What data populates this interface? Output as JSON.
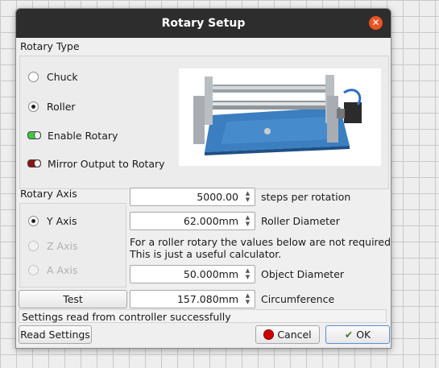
{
  "window": {
    "title": "Rotary Setup"
  },
  "rotary_type": {
    "heading": "Rotary Type",
    "options": [
      {
        "label": "Chuck",
        "selected": false
      },
      {
        "label": "Roller",
        "selected": true
      }
    ],
    "enable_rotary": {
      "label": "Enable Rotary",
      "on": true,
      "color": "#3ec93e"
    },
    "mirror_output": {
      "label": "Mirror Output to Rotary",
      "on": false,
      "color": "#8b1414"
    }
  },
  "rotary_axis": {
    "heading": "Rotary Axis",
    "options": [
      {
        "label": "Y Axis",
        "selected": true,
        "enabled": true
      },
      {
        "label": "Z Axis",
        "selected": false,
        "enabled": false
      },
      {
        "label": "A Axis",
        "selected": false,
        "enabled": false
      }
    ],
    "test_label": "Test"
  },
  "fields": {
    "steps": {
      "value": "5000.00",
      "label": "steps per rotation"
    },
    "roller_diameter": {
      "value": "62.000mm",
      "label": "Roller Diameter"
    },
    "note_line1": "For a roller rotary the values below are not required.",
    "note_line2": "This is just a useful calculator.",
    "object_diameter": {
      "value": "50.000mm",
      "label": "Object Diameter"
    },
    "circumference": {
      "value": "157.080mm",
      "label": "Circumference"
    }
  },
  "status": "Settings read from controller successfully",
  "buttons": {
    "read_settings": "Read Settings",
    "cancel": "Cancel",
    "ok": "OK"
  },
  "colors": {
    "titlebar": "#2d2d2d",
    "close": "#e95420",
    "cancel_icon": "#d00000"
  }
}
